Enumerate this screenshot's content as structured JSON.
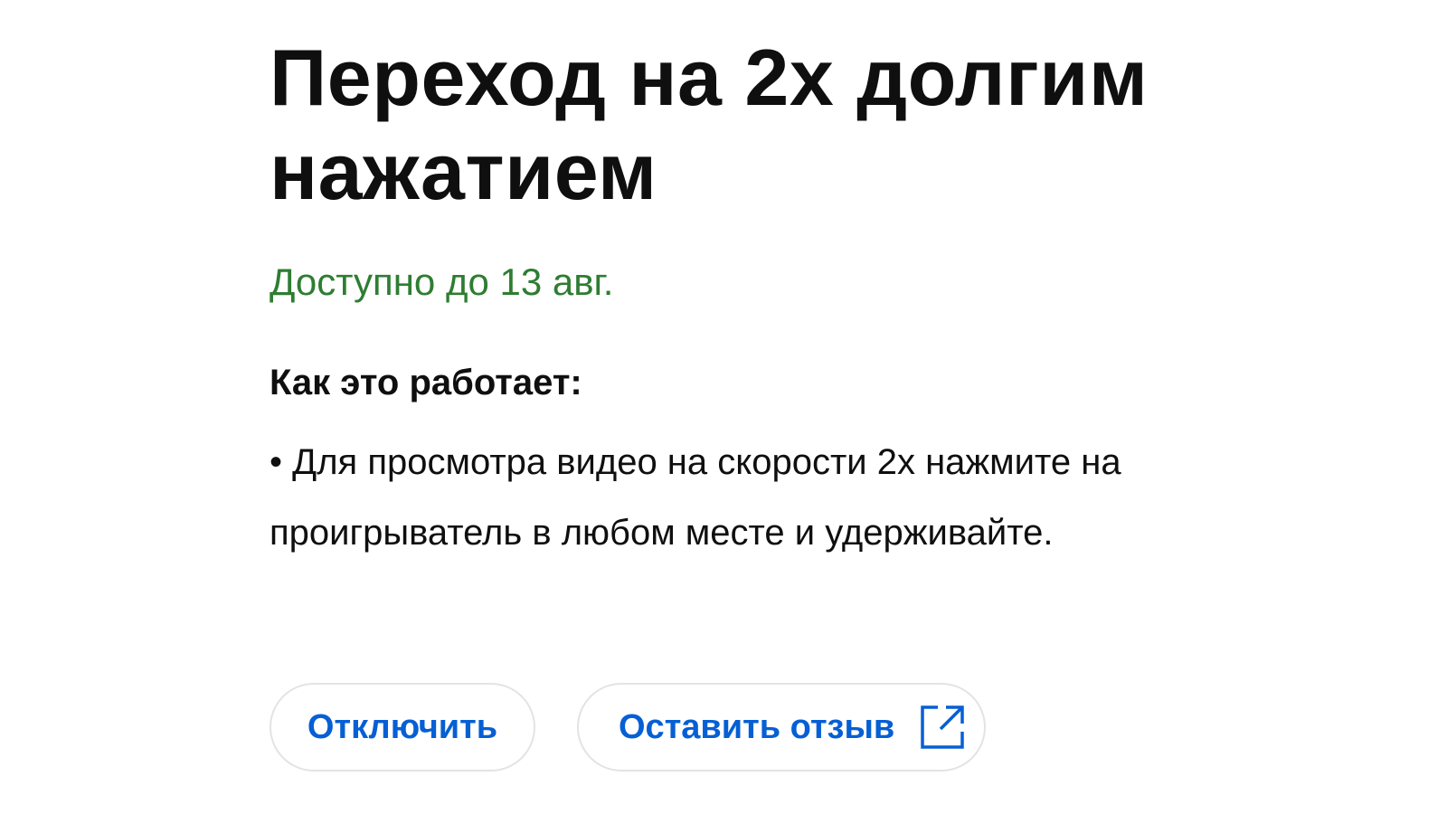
{
  "feature": {
    "title": "Переход на 2x долгим нажатием",
    "availability": "Доступно до 13 авг.",
    "how_heading": "Как это работает:",
    "how_body": "• Для просмотра видео на скорости 2x нажмите на проигрыватель в любом месте и удерживайте."
  },
  "actions": {
    "disable_label": "Отключить",
    "feedback_label": "Оставить отзыв",
    "feedback_icon": "external-link-icon"
  },
  "colors": {
    "availability": "#2e7d32",
    "button_text": "#065fd4",
    "button_border": "#e3e3e3"
  }
}
